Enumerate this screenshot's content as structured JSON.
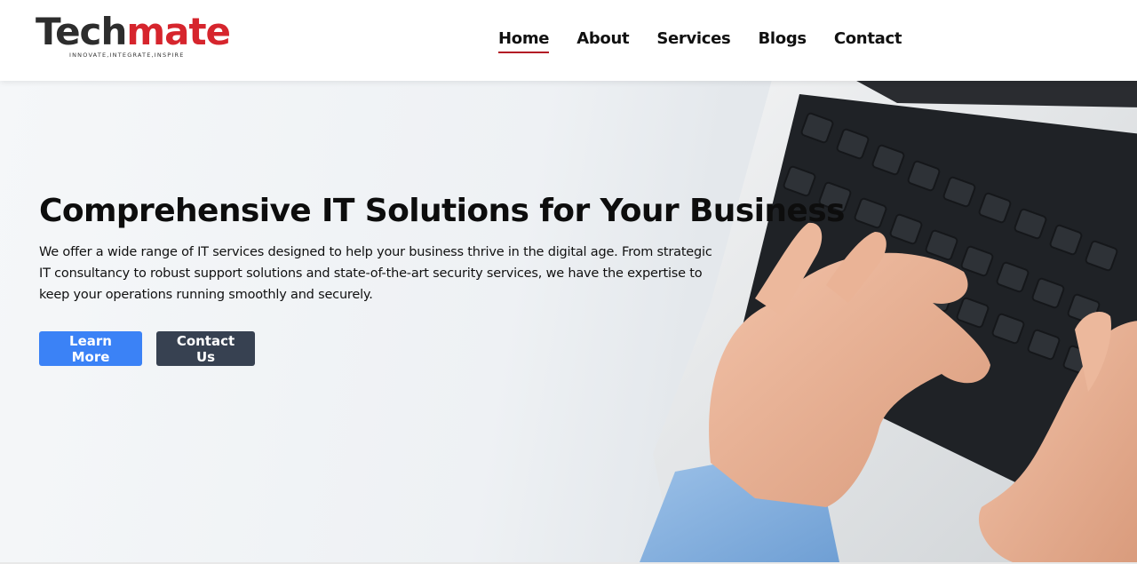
{
  "header": {
    "logo": {
      "part1": "Tech",
      "part2": "mate",
      "tagline": "INNOVATE,INTEGRATE,INSPIRE"
    },
    "nav": [
      {
        "label": "Home",
        "active": true
      },
      {
        "label": "About",
        "active": false
      },
      {
        "label": "Services",
        "active": false
      },
      {
        "label": "Blogs",
        "active": false
      },
      {
        "label": "Contact",
        "active": false
      }
    ]
  },
  "hero": {
    "title": "Comprehensive IT Solutions for Your Business",
    "description": "We offer a wide range of IT services designed to help your business thrive in the digital age. From strategic IT consultancy to robust support solutions and state-of-the-art security services, we have the expertise to keep your operations running smoothly and securely.",
    "primary_button": "Learn More",
    "secondary_button": "Contact Us",
    "image_subject": "hands typing on laptop keyboard"
  },
  "colors": {
    "brand_red": "#d6252d",
    "brand_dark": "#2d2d2d",
    "primary_blue": "#3b82f6",
    "secondary_gray": "#374151",
    "nav_underline": "#b31b25"
  }
}
